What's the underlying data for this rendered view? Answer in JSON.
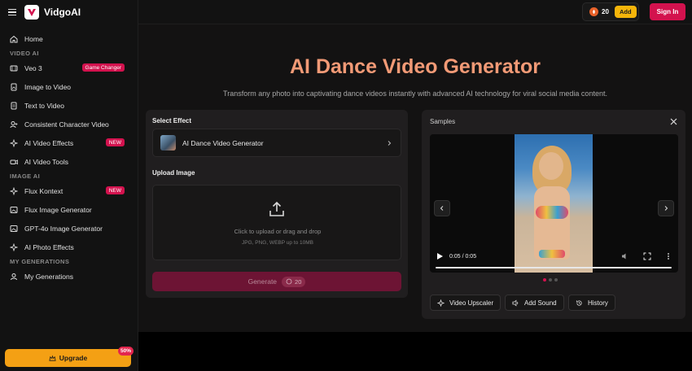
{
  "app": {
    "name": "VidgoAI"
  },
  "sidebar": {
    "home": "Home",
    "sections": {
      "video_ai": "VIDEO AI",
      "image_ai": "IMAGE AI",
      "my_generations": "MY GENERATIONS"
    },
    "video_items": [
      {
        "label": "Veo 3",
        "badge": "Game Changer",
        "icon": "film-icon"
      },
      {
        "label": "Image to Video",
        "icon": "image-file-icon"
      },
      {
        "label": "Text to Video",
        "icon": "text-file-icon"
      },
      {
        "label": "Consistent Character Video",
        "icon": "person-icon"
      },
      {
        "label": "AI Video Effects",
        "badge": "NEW",
        "icon": "sparkle-icon"
      },
      {
        "label": "AI Video Tools",
        "icon": "video-camera-icon"
      }
    ],
    "image_items": [
      {
        "label": "Flux Kontext",
        "badge": "NEW",
        "icon": "sparkle-icon"
      },
      {
        "label": "Flux Image Generator",
        "icon": "image-icon"
      },
      {
        "label": "GPT-4o Image Generator",
        "icon": "image-icon"
      },
      {
        "label": "AI Photo Effects",
        "icon": "sparkle-icon"
      }
    ],
    "gen_items": [
      {
        "label": "My Generations",
        "icon": "person-icon"
      }
    ],
    "upgrade": {
      "label": "Upgrade",
      "badge": "50%"
    }
  },
  "topbar": {
    "credits": "20",
    "add_label": "Add",
    "signin_label": "Sign In"
  },
  "hero": {
    "title": "AI Dance Video Generator",
    "subtitle": "Transform any photo into captivating dance videos instantly with advanced AI technology for viral social media content."
  },
  "form": {
    "select_effect_label": "Select Effect",
    "effect_value": "AI Dance Video Generator",
    "upload_label": "Upload Image",
    "upload_text": "Click to upload or drag and drop",
    "upload_hint": "JPG, PNG, WEBP up to 10MB",
    "generate_label": "Generate",
    "generate_cost": "20"
  },
  "samples": {
    "title": "Samples",
    "time": "0:05 / 0:05",
    "tools": [
      {
        "label": "Video Upscaler",
        "icon": "sparkle-icon"
      },
      {
        "label": "Add Sound",
        "icon": "speaker-icon"
      },
      {
        "label": "History",
        "icon": "history-icon"
      }
    ]
  },
  "colors": {
    "accent": "#d3124e",
    "title": "#f29a76",
    "upgrade": "#f4a014",
    "add": "#f5b50a"
  }
}
